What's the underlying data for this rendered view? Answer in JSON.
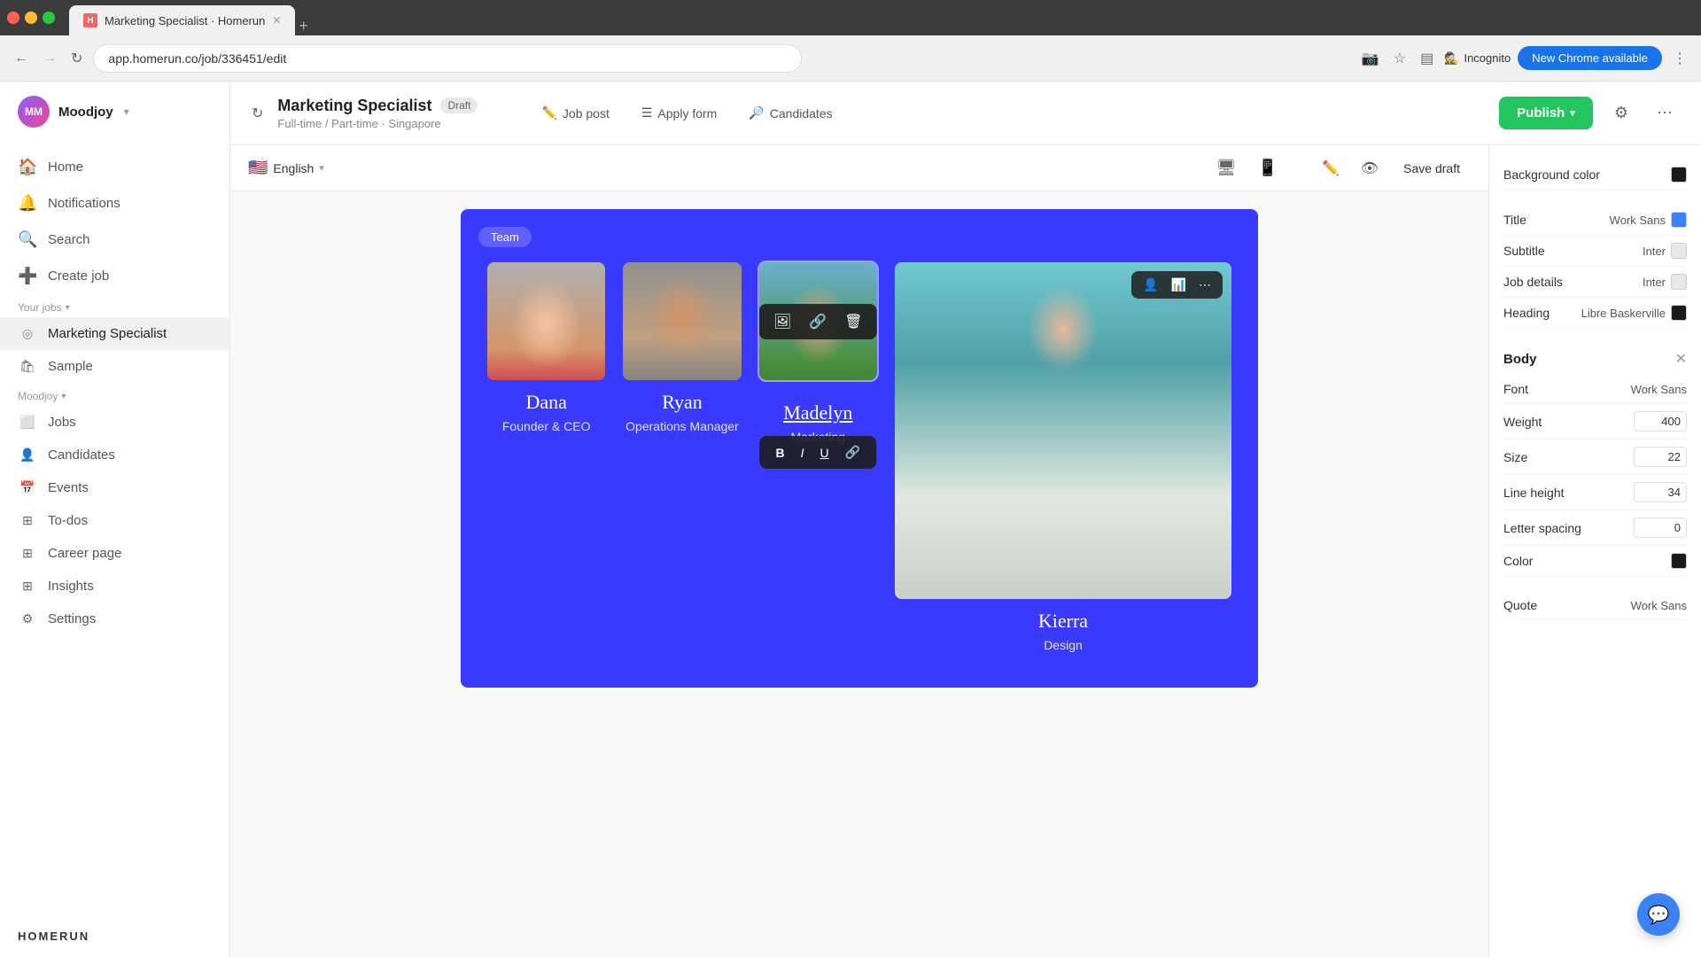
{
  "browser": {
    "tab_title": "Marketing Specialist · Homerun",
    "tab_favicon_alt": "H",
    "url": "app.homerun.co/job/336451/edit",
    "new_chrome_label": "New Chrome available",
    "incognito_label": "Incognito",
    "window_controls": {
      "minimize": "−",
      "maximize": "□",
      "close": "×"
    }
  },
  "sidebar": {
    "avatar": "MM",
    "company": "Moodjoy",
    "nav_items": [
      {
        "id": "home",
        "label": "Home",
        "icon": "🏠"
      },
      {
        "id": "notifications",
        "label": "Notifications",
        "icon": "🔔"
      },
      {
        "id": "search",
        "label": "Search",
        "icon": "🔍"
      },
      {
        "id": "create-job",
        "label": "Create job",
        "icon": "➕"
      }
    ],
    "your_jobs_label": "Your jobs",
    "jobs": [
      {
        "id": "marketing-specialist",
        "label": "Marketing Specialist",
        "icon": "◎",
        "active": true
      },
      {
        "id": "sample",
        "label": "Sample",
        "icon": "🛍"
      }
    ],
    "moodjoy_label": "Moodjoy",
    "moodjoy_items": [
      {
        "id": "jobs",
        "label": "Jobs",
        "icon": "⬜"
      },
      {
        "id": "candidates",
        "label": "Candidates",
        "icon": "👤"
      },
      {
        "id": "events",
        "label": "Events",
        "icon": "📅"
      },
      {
        "id": "todos",
        "label": "To-dos",
        "icon": "⊞"
      },
      {
        "id": "career-page",
        "label": "Career page",
        "icon": "⊞"
      },
      {
        "id": "insights",
        "label": "Insights",
        "icon": "⊞"
      },
      {
        "id": "settings",
        "label": "Settings",
        "icon": "⚙"
      }
    ],
    "logo": "HOMERUN"
  },
  "header": {
    "job_title": "Marketing Specialist",
    "draft_badge": "Draft",
    "job_meta": "Full-time / Part-time · Singapore",
    "tabs": [
      {
        "id": "job-post",
        "label": "Job post",
        "icon": "✏"
      },
      {
        "id": "apply-form",
        "label": "Apply form",
        "icon": "☰"
      },
      {
        "id": "candidates",
        "label": "Candidates",
        "icon": "🔎"
      }
    ],
    "publish_label": "Publish",
    "settings_icon": "⚙",
    "more_icon": "⋯"
  },
  "canvas": {
    "language": "English",
    "flag": "🇺🇸",
    "device_icons": [
      "🖥",
      "📱"
    ],
    "right_tools": [
      "✏",
      "👁"
    ],
    "save_draft_label": "Save draft",
    "team_badge": "Team",
    "team_members": [
      {
        "id": "dana",
        "name": "Dana",
        "role": "Founder & CEO"
      },
      {
        "id": "ryan",
        "name": "Ryan",
        "role": "Operations Manager"
      },
      {
        "id": "madelyn",
        "name": "Madelyn",
        "role": "Marketing"
      },
      {
        "id": "kierra",
        "name": "Kierra",
        "role": "Design"
      }
    ],
    "image_toolbar": {
      "image_icon": "🖼",
      "link_icon": "🔗",
      "delete_icon": "🗑"
    },
    "text_toolbar": {
      "bold": "B",
      "italic": "I",
      "underline": "U",
      "link": "🔗"
    }
  },
  "right_panel": {
    "background_color_label": "Background color",
    "background_color_value": "#1a1a1a",
    "typography": {
      "title": {
        "label": "Title",
        "font": "Work Sans",
        "color": "#3b82f6"
      },
      "subtitle": {
        "label": "Subtitle",
        "font": "Inter",
        "color": "#e8e8e8"
      },
      "job_details": {
        "label": "Job details",
        "font": "Inter",
        "color": "#e8e8e8"
      },
      "heading": {
        "label": "Heading",
        "font": "Libre Baskerville",
        "color": "#1a1a1a"
      }
    },
    "body_section": {
      "label": "Body",
      "font_label": "Font",
      "font_value": "Work Sans",
      "weight_label": "Weight",
      "weight_value": "400",
      "size_label": "Size",
      "size_value": "22",
      "line_height_label": "Line height",
      "line_height_value": "34",
      "letter_spacing_label": "Letter spacing",
      "letter_spacing_value": "0",
      "color_label": "Color",
      "color_value": "#1a1a1a"
    },
    "quote": {
      "label": "Quote",
      "font": "Work Sans"
    }
  }
}
